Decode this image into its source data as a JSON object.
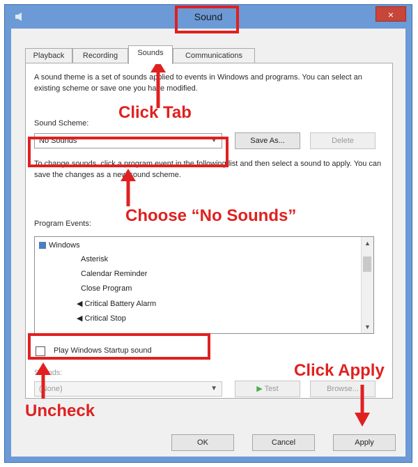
{
  "window": {
    "title": "Sound",
    "close_glyph": "×"
  },
  "tabs": [
    {
      "label": "Playback"
    },
    {
      "label": "Recording"
    },
    {
      "label": "Sounds"
    },
    {
      "label": "Communications"
    }
  ],
  "description": "A sound theme is a set of sounds applied to events in Windows and programs. You can select an existing scheme or save one you have modified.",
  "scheme": {
    "label": "Sound Scheme:",
    "selected": "No Sounds",
    "save_as": "Save As...",
    "delete": "Delete"
  },
  "instructions": "To change sounds, click a program event in the following list and then select a sound to apply. You can save the changes as a new sound scheme.",
  "events": {
    "label": "Program Events:",
    "group": "Windows",
    "items": [
      "Asterisk",
      "Calendar Reminder",
      "Close Program",
      "Critical Battery Alarm",
      "Critical Stop"
    ]
  },
  "startup": {
    "label": "Play Windows Startup sound",
    "checked": false
  },
  "sounds": {
    "label": "Sounds:",
    "selected": "(None)",
    "test": "Test",
    "browse": "Browse..."
  },
  "footer": {
    "ok": "OK",
    "cancel": "Cancel",
    "apply": "Apply"
  },
  "annotations": {
    "click_tab": "Click Tab",
    "choose_no_sounds": "Choose “No Sounds”",
    "click_apply": "Click Apply",
    "uncheck": "Uncheck"
  },
  "colors": {
    "annotation": "#e02020",
    "title_bar": "#6b9ad6",
    "close_button": "#c8453a"
  }
}
